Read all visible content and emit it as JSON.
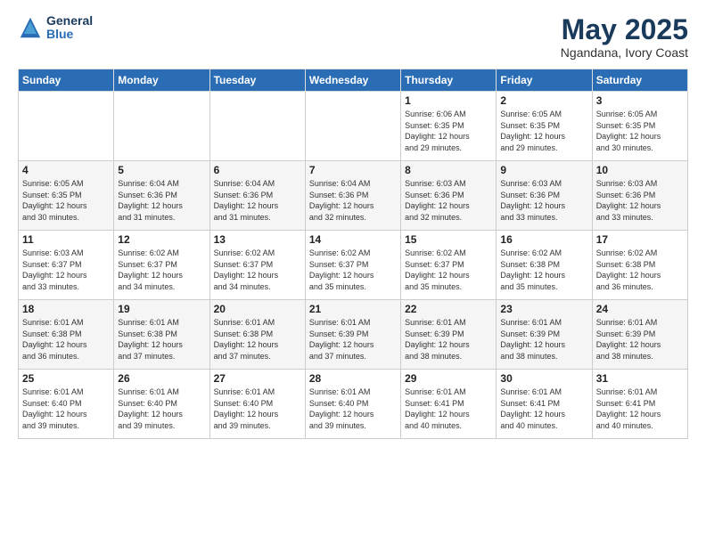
{
  "logo": {
    "line1": "General",
    "line2": "Blue"
  },
  "title": "May 2025",
  "subtitle": "Ngandana, Ivory Coast",
  "days": [
    "Sunday",
    "Monday",
    "Tuesday",
    "Wednesday",
    "Thursday",
    "Friday",
    "Saturday"
  ],
  "weeks": [
    [
      {
        "day": "",
        "content": ""
      },
      {
        "day": "",
        "content": ""
      },
      {
        "day": "",
        "content": ""
      },
      {
        "day": "",
        "content": ""
      },
      {
        "day": "1",
        "content": "Sunrise: 6:06 AM\nSunset: 6:35 PM\nDaylight: 12 hours\nand 29 minutes."
      },
      {
        "day": "2",
        "content": "Sunrise: 6:05 AM\nSunset: 6:35 PM\nDaylight: 12 hours\nand 29 minutes."
      },
      {
        "day": "3",
        "content": "Sunrise: 6:05 AM\nSunset: 6:35 PM\nDaylight: 12 hours\nand 30 minutes."
      }
    ],
    [
      {
        "day": "4",
        "content": "Sunrise: 6:05 AM\nSunset: 6:35 PM\nDaylight: 12 hours\nand 30 minutes."
      },
      {
        "day": "5",
        "content": "Sunrise: 6:04 AM\nSunset: 6:36 PM\nDaylight: 12 hours\nand 31 minutes."
      },
      {
        "day": "6",
        "content": "Sunrise: 6:04 AM\nSunset: 6:36 PM\nDaylight: 12 hours\nand 31 minutes."
      },
      {
        "day": "7",
        "content": "Sunrise: 6:04 AM\nSunset: 6:36 PM\nDaylight: 12 hours\nand 32 minutes."
      },
      {
        "day": "8",
        "content": "Sunrise: 6:03 AM\nSunset: 6:36 PM\nDaylight: 12 hours\nand 32 minutes."
      },
      {
        "day": "9",
        "content": "Sunrise: 6:03 AM\nSunset: 6:36 PM\nDaylight: 12 hours\nand 33 minutes."
      },
      {
        "day": "10",
        "content": "Sunrise: 6:03 AM\nSunset: 6:36 PM\nDaylight: 12 hours\nand 33 minutes."
      }
    ],
    [
      {
        "day": "11",
        "content": "Sunrise: 6:03 AM\nSunset: 6:37 PM\nDaylight: 12 hours\nand 33 minutes."
      },
      {
        "day": "12",
        "content": "Sunrise: 6:02 AM\nSunset: 6:37 PM\nDaylight: 12 hours\nand 34 minutes."
      },
      {
        "day": "13",
        "content": "Sunrise: 6:02 AM\nSunset: 6:37 PM\nDaylight: 12 hours\nand 34 minutes."
      },
      {
        "day": "14",
        "content": "Sunrise: 6:02 AM\nSunset: 6:37 PM\nDaylight: 12 hours\nand 35 minutes."
      },
      {
        "day": "15",
        "content": "Sunrise: 6:02 AM\nSunset: 6:37 PM\nDaylight: 12 hours\nand 35 minutes."
      },
      {
        "day": "16",
        "content": "Sunrise: 6:02 AM\nSunset: 6:38 PM\nDaylight: 12 hours\nand 35 minutes."
      },
      {
        "day": "17",
        "content": "Sunrise: 6:02 AM\nSunset: 6:38 PM\nDaylight: 12 hours\nand 36 minutes."
      }
    ],
    [
      {
        "day": "18",
        "content": "Sunrise: 6:01 AM\nSunset: 6:38 PM\nDaylight: 12 hours\nand 36 minutes."
      },
      {
        "day": "19",
        "content": "Sunrise: 6:01 AM\nSunset: 6:38 PM\nDaylight: 12 hours\nand 37 minutes."
      },
      {
        "day": "20",
        "content": "Sunrise: 6:01 AM\nSunset: 6:38 PM\nDaylight: 12 hours\nand 37 minutes."
      },
      {
        "day": "21",
        "content": "Sunrise: 6:01 AM\nSunset: 6:39 PM\nDaylight: 12 hours\nand 37 minutes."
      },
      {
        "day": "22",
        "content": "Sunrise: 6:01 AM\nSunset: 6:39 PM\nDaylight: 12 hours\nand 38 minutes."
      },
      {
        "day": "23",
        "content": "Sunrise: 6:01 AM\nSunset: 6:39 PM\nDaylight: 12 hours\nand 38 minutes."
      },
      {
        "day": "24",
        "content": "Sunrise: 6:01 AM\nSunset: 6:39 PM\nDaylight: 12 hours\nand 38 minutes."
      }
    ],
    [
      {
        "day": "25",
        "content": "Sunrise: 6:01 AM\nSunset: 6:40 PM\nDaylight: 12 hours\nand 39 minutes."
      },
      {
        "day": "26",
        "content": "Sunrise: 6:01 AM\nSunset: 6:40 PM\nDaylight: 12 hours\nand 39 minutes."
      },
      {
        "day": "27",
        "content": "Sunrise: 6:01 AM\nSunset: 6:40 PM\nDaylight: 12 hours\nand 39 minutes."
      },
      {
        "day": "28",
        "content": "Sunrise: 6:01 AM\nSunset: 6:40 PM\nDaylight: 12 hours\nand 39 minutes."
      },
      {
        "day": "29",
        "content": "Sunrise: 6:01 AM\nSunset: 6:41 PM\nDaylight: 12 hours\nand 40 minutes."
      },
      {
        "day": "30",
        "content": "Sunrise: 6:01 AM\nSunset: 6:41 PM\nDaylight: 12 hours\nand 40 minutes."
      },
      {
        "day": "31",
        "content": "Sunrise: 6:01 AM\nSunset: 6:41 PM\nDaylight: 12 hours\nand 40 minutes."
      }
    ]
  ]
}
